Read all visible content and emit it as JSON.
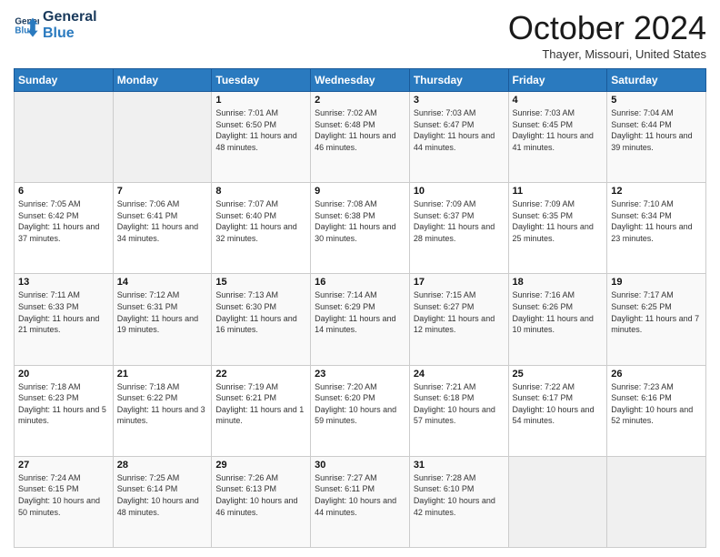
{
  "logo": {
    "line1": "General",
    "line2": "Blue"
  },
  "header": {
    "month": "October 2024",
    "location": "Thayer, Missouri, United States"
  },
  "weekdays": [
    "Sunday",
    "Monday",
    "Tuesday",
    "Wednesday",
    "Thursday",
    "Friday",
    "Saturday"
  ],
  "weeks": [
    [
      {
        "day": "",
        "sunrise": "",
        "sunset": "",
        "daylight": ""
      },
      {
        "day": "",
        "sunrise": "",
        "sunset": "",
        "daylight": ""
      },
      {
        "day": "1",
        "sunrise": "Sunrise: 7:01 AM",
        "sunset": "Sunset: 6:50 PM",
        "daylight": "Daylight: 11 hours and 48 minutes."
      },
      {
        "day": "2",
        "sunrise": "Sunrise: 7:02 AM",
        "sunset": "Sunset: 6:48 PM",
        "daylight": "Daylight: 11 hours and 46 minutes."
      },
      {
        "day": "3",
        "sunrise": "Sunrise: 7:03 AM",
        "sunset": "Sunset: 6:47 PM",
        "daylight": "Daylight: 11 hours and 44 minutes."
      },
      {
        "day": "4",
        "sunrise": "Sunrise: 7:03 AM",
        "sunset": "Sunset: 6:45 PM",
        "daylight": "Daylight: 11 hours and 41 minutes."
      },
      {
        "day": "5",
        "sunrise": "Sunrise: 7:04 AM",
        "sunset": "Sunset: 6:44 PM",
        "daylight": "Daylight: 11 hours and 39 minutes."
      }
    ],
    [
      {
        "day": "6",
        "sunrise": "Sunrise: 7:05 AM",
        "sunset": "Sunset: 6:42 PM",
        "daylight": "Daylight: 11 hours and 37 minutes."
      },
      {
        "day": "7",
        "sunrise": "Sunrise: 7:06 AM",
        "sunset": "Sunset: 6:41 PM",
        "daylight": "Daylight: 11 hours and 34 minutes."
      },
      {
        "day": "8",
        "sunrise": "Sunrise: 7:07 AM",
        "sunset": "Sunset: 6:40 PM",
        "daylight": "Daylight: 11 hours and 32 minutes."
      },
      {
        "day": "9",
        "sunrise": "Sunrise: 7:08 AM",
        "sunset": "Sunset: 6:38 PM",
        "daylight": "Daylight: 11 hours and 30 minutes."
      },
      {
        "day": "10",
        "sunrise": "Sunrise: 7:09 AM",
        "sunset": "Sunset: 6:37 PM",
        "daylight": "Daylight: 11 hours and 28 minutes."
      },
      {
        "day": "11",
        "sunrise": "Sunrise: 7:09 AM",
        "sunset": "Sunset: 6:35 PM",
        "daylight": "Daylight: 11 hours and 25 minutes."
      },
      {
        "day": "12",
        "sunrise": "Sunrise: 7:10 AM",
        "sunset": "Sunset: 6:34 PM",
        "daylight": "Daylight: 11 hours and 23 minutes."
      }
    ],
    [
      {
        "day": "13",
        "sunrise": "Sunrise: 7:11 AM",
        "sunset": "Sunset: 6:33 PM",
        "daylight": "Daylight: 11 hours and 21 minutes."
      },
      {
        "day": "14",
        "sunrise": "Sunrise: 7:12 AM",
        "sunset": "Sunset: 6:31 PM",
        "daylight": "Daylight: 11 hours and 19 minutes."
      },
      {
        "day": "15",
        "sunrise": "Sunrise: 7:13 AM",
        "sunset": "Sunset: 6:30 PM",
        "daylight": "Daylight: 11 hours and 16 minutes."
      },
      {
        "day": "16",
        "sunrise": "Sunrise: 7:14 AM",
        "sunset": "Sunset: 6:29 PM",
        "daylight": "Daylight: 11 hours and 14 minutes."
      },
      {
        "day": "17",
        "sunrise": "Sunrise: 7:15 AM",
        "sunset": "Sunset: 6:27 PM",
        "daylight": "Daylight: 11 hours and 12 minutes."
      },
      {
        "day": "18",
        "sunrise": "Sunrise: 7:16 AM",
        "sunset": "Sunset: 6:26 PM",
        "daylight": "Daylight: 11 hours and 10 minutes."
      },
      {
        "day": "19",
        "sunrise": "Sunrise: 7:17 AM",
        "sunset": "Sunset: 6:25 PM",
        "daylight": "Daylight: 11 hours and 7 minutes."
      }
    ],
    [
      {
        "day": "20",
        "sunrise": "Sunrise: 7:18 AM",
        "sunset": "Sunset: 6:23 PM",
        "daylight": "Daylight: 11 hours and 5 minutes."
      },
      {
        "day": "21",
        "sunrise": "Sunrise: 7:18 AM",
        "sunset": "Sunset: 6:22 PM",
        "daylight": "Daylight: 11 hours and 3 minutes."
      },
      {
        "day": "22",
        "sunrise": "Sunrise: 7:19 AM",
        "sunset": "Sunset: 6:21 PM",
        "daylight": "Daylight: 11 hours and 1 minute."
      },
      {
        "day": "23",
        "sunrise": "Sunrise: 7:20 AM",
        "sunset": "Sunset: 6:20 PM",
        "daylight": "Daylight: 10 hours and 59 minutes."
      },
      {
        "day": "24",
        "sunrise": "Sunrise: 7:21 AM",
        "sunset": "Sunset: 6:18 PM",
        "daylight": "Daylight: 10 hours and 57 minutes."
      },
      {
        "day": "25",
        "sunrise": "Sunrise: 7:22 AM",
        "sunset": "Sunset: 6:17 PM",
        "daylight": "Daylight: 10 hours and 54 minutes."
      },
      {
        "day": "26",
        "sunrise": "Sunrise: 7:23 AM",
        "sunset": "Sunset: 6:16 PM",
        "daylight": "Daylight: 10 hours and 52 minutes."
      }
    ],
    [
      {
        "day": "27",
        "sunrise": "Sunrise: 7:24 AM",
        "sunset": "Sunset: 6:15 PM",
        "daylight": "Daylight: 10 hours and 50 minutes."
      },
      {
        "day": "28",
        "sunrise": "Sunrise: 7:25 AM",
        "sunset": "Sunset: 6:14 PM",
        "daylight": "Daylight: 10 hours and 48 minutes."
      },
      {
        "day": "29",
        "sunrise": "Sunrise: 7:26 AM",
        "sunset": "Sunset: 6:13 PM",
        "daylight": "Daylight: 10 hours and 46 minutes."
      },
      {
        "day": "30",
        "sunrise": "Sunrise: 7:27 AM",
        "sunset": "Sunset: 6:11 PM",
        "daylight": "Daylight: 10 hours and 44 minutes."
      },
      {
        "day": "31",
        "sunrise": "Sunrise: 7:28 AM",
        "sunset": "Sunset: 6:10 PM",
        "daylight": "Daylight: 10 hours and 42 minutes."
      },
      {
        "day": "",
        "sunrise": "",
        "sunset": "",
        "daylight": ""
      },
      {
        "day": "",
        "sunrise": "",
        "sunset": "",
        "daylight": ""
      }
    ]
  ]
}
